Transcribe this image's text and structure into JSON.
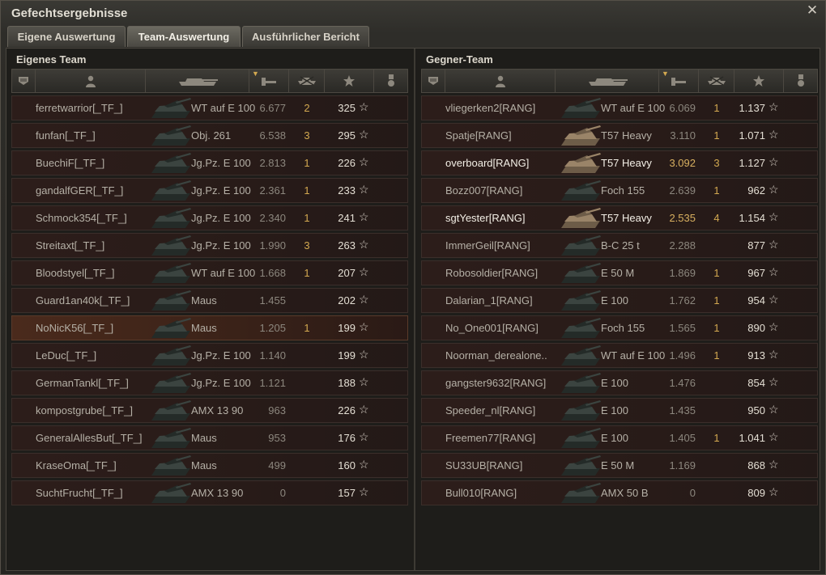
{
  "window": {
    "title": "Gefechtsergebnisse"
  },
  "tabs": [
    {
      "label": "Eigene Auswertung",
      "active": false
    },
    {
      "label": "Team-Auswertung",
      "active": true
    },
    {
      "label": "Ausführlicher Bericht",
      "active": false
    }
  ],
  "colors": {
    "accent_gold": "#d2a850",
    "row_bg": "#2c1d1a",
    "highlight_bg": "#4a2a1c"
  },
  "header_icons": [
    "platoon-icon",
    "player-icon",
    "tank-icon",
    "damage-icon",
    "kills-icon",
    "xp-star-icon",
    "medal-icon"
  ],
  "own_team": {
    "title": "Eigenes Team",
    "rows": [
      {
        "player": "ferretwarrior[_TF_]",
        "tank": "WT auf E 100",
        "score": "6.677",
        "kills": "2",
        "xp": "325"
      },
      {
        "player": "funfan[_TF_]",
        "tank": "Obj. 261",
        "score": "6.538",
        "kills": "3",
        "xp": "295"
      },
      {
        "player": "BuechiF[_TF_]",
        "tank": "Jg.Pz. E 100",
        "score": "2.813",
        "kills": "1",
        "xp": "226"
      },
      {
        "player": "gandalfGER[_TF_]",
        "tank": "Jg.Pz. E 100",
        "score": "2.361",
        "kills": "1",
        "xp": "233"
      },
      {
        "player": "Schmock354[_TF_]",
        "tank": "Jg.Pz. E 100",
        "score": "2.340",
        "kills": "1",
        "xp": "241"
      },
      {
        "player": "Streitaxt[_TF_]",
        "tank": "Jg.Pz. E 100",
        "score": "1.990",
        "kills": "3",
        "xp": "263"
      },
      {
        "player": "Bloodstyel[_TF_]",
        "tank": "WT auf E 100",
        "score": "1.668",
        "kills": "1",
        "xp": "207"
      },
      {
        "player": "Guard1an40k[_TF_]",
        "tank": "Maus",
        "score": "1.455",
        "kills": "",
        "xp": "202"
      },
      {
        "player": "NoNicK56[_TF_]",
        "tank": "Maus",
        "score": "1.205",
        "kills": "1",
        "xp": "199",
        "highlight": true
      },
      {
        "player": "LeDuc[_TF_]",
        "tank": "Jg.Pz. E 100",
        "score": "1.140",
        "kills": "",
        "xp": "199"
      },
      {
        "player": "GermanTankl[_TF_]",
        "tank": "Jg.Pz. E 100",
        "score": "1.121",
        "kills": "",
        "xp": "188"
      },
      {
        "player": "kompostgrube[_TF_]",
        "tank": "AMX 13 90",
        "score": "963",
        "kills": "",
        "xp": "226"
      },
      {
        "player": "GeneralAllesBut[_TF_]",
        "tank": "Maus",
        "score": "953",
        "kills": "",
        "xp": "176"
      },
      {
        "player": "KraseOma[_TF_]",
        "tank": "Maus",
        "score": "499",
        "kills": "",
        "xp": "160"
      },
      {
        "player": "SuchtFrucht[_TF_]",
        "tank": "AMX 13 90",
        "score": "0",
        "kills": "",
        "xp": "157"
      }
    ]
  },
  "enemy_team": {
    "title": "Gegner-Team",
    "rows": [
      {
        "player": "vliegerken2[RANG]",
        "tank": "WT auf E 100",
        "score": "6.069",
        "kills": "1",
        "xp": "1.137"
      },
      {
        "player": "Spatje[RANG]",
        "tank": "T57 Heavy",
        "score": "3.110",
        "kills": "1",
        "xp": "1.071"
      },
      {
        "player": "overboard[RANG]",
        "tank": "T57 Heavy",
        "score": "3.092",
        "kills": "3",
        "xp": "1.127",
        "bold": true
      },
      {
        "player": "Bozz007[RANG]",
        "tank": "Foch 155",
        "score": "2.639",
        "kills": "1",
        "xp": "962"
      },
      {
        "player": "sgtYester[RANG]",
        "tank": "T57 Heavy",
        "score": "2.535",
        "kills": "4",
        "xp": "1.154",
        "bold": true
      },
      {
        "player": "ImmerGeil[RANG]",
        "tank": "B-C 25 t",
        "score": "2.288",
        "kills": "",
        "xp": "877"
      },
      {
        "player": "Robosoldier[RANG]",
        "tank": "E 50 M",
        "score": "1.869",
        "kills": "1",
        "xp": "967"
      },
      {
        "player": "Dalarian_1[RANG]",
        "tank": "E 100",
        "score": "1.762",
        "kills": "1",
        "xp": "954"
      },
      {
        "player": "No_One001[RANG]",
        "tank": "Foch 155",
        "score": "1.565",
        "kills": "1",
        "xp": "890"
      },
      {
        "player": "Noorman_derealone..",
        "tank": "WT auf E 100",
        "score": "1.496",
        "kills": "1",
        "xp": "913"
      },
      {
        "player": "gangster9632[RANG]",
        "tank": "E 100",
        "score": "1.476",
        "kills": "",
        "xp": "854"
      },
      {
        "player": "Speeder_nl[RANG]",
        "tank": "E 100",
        "score": "1.435",
        "kills": "",
        "xp": "950"
      },
      {
        "player": "Freemen77[RANG]",
        "tank": "E 100",
        "score": "1.405",
        "kills": "1",
        "xp": "1.041"
      },
      {
        "player": "SU33UB[RANG]",
        "tank": "E 50 M",
        "score": "1.169",
        "kills": "",
        "xp": "868"
      },
      {
        "player": "Bull010[RANG]",
        "tank": "AMX 50 B",
        "score": "0",
        "kills": "",
        "xp": "809"
      }
    ]
  }
}
